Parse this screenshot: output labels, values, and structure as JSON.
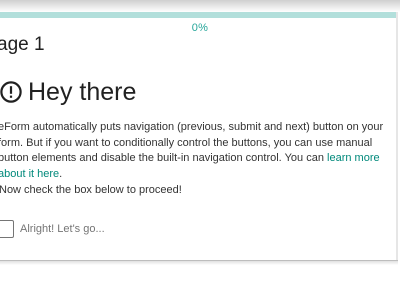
{
  "progress": {
    "label": "0%",
    "value": 0,
    "fill_color": "#26a69a",
    "track_color": "#b2dfdb"
  },
  "page": {
    "title": "age 1"
  },
  "content": {
    "heading_icon": "alert-circle-icon",
    "heading": "Hey there",
    "paragraph_prefix": "eForm automatically puts navigation (previous, submit and next) button on your form. But if you want to conditionally control the buttons, you can use manual button elements and disable the built-in navigation control. You can ",
    "paragraph_link": "learn more about it here",
    "paragraph_suffix": ".",
    "instruction": "Now check the box below to proceed!",
    "checkbox_label": "Alright! Let's go...",
    "checkbox_checked": false,
    "link_color": "#00897b"
  }
}
